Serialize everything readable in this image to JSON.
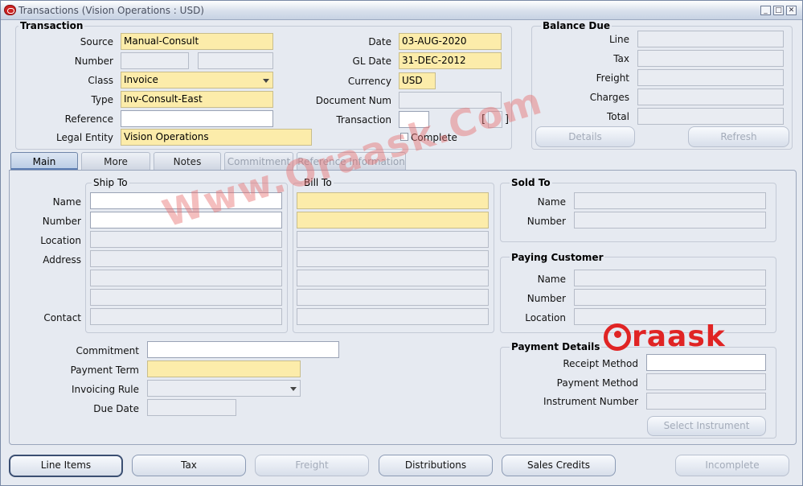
{
  "window": {
    "title": "Transactions (Vision Operations : USD)"
  },
  "transaction": {
    "section_title": "Transaction",
    "source_label": "Source",
    "source_value": "Manual-Consult",
    "number_label": "Number",
    "number_value": "",
    "class_label": "Class",
    "class_value": "Invoice",
    "type_label": "Type",
    "type_value": "Inv-Consult-East",
    "reference_label": "Reference",
    "reference_value": "",
    "legal_entity_label": "Legal Entity",
    "legal_entity_value": "Vision Operations",
    "date_label": "Date",
    "date_value": "03-AUG-2020",
    "gl_date_label": "GL Date",
    "gl_date_value": "31-DEC-2012",
    "currency_label": "Currency",
    "currency_value": "USD",
    "document_num_label": "Document Num",
    "document_num_value": "",
    "transaction_label": "Transaction",
    "transaction_value": "",
    "complete_label": "Complete",
    "complete_checked": false,
    "bracket_open": "[",
    "bracket_close": "]"
  },
  "balance_due": {
    "section_title": "Balance Due",
    "line_label": "Line",
    "tax_label": "Tax",
    "freight_label": "Freight",
    "charges_label": "Charges",
    "total_label": "Total",
    "details_button": "Details",
    "refresh_button": "Refresh"
  },
  "tabs": [
    {
      "label": "Main",
      "state": "active"
    },
    {
      "label": "More",
      "state": "normal"
    },
    {
      "label": "Notes",
      "state": "normal"
    },
    {
      "label": "Commitment",
      "state": "disabled"
    },
    {
      "label": "Reference Information",
      "state": "disabled"
    }
  ],
  "ship_to": {
    "section_title": "Ship To",
    "name_label": "Name",
    "number_label": "Number",
    "location_label": "Location",
    "address_label": "Address",
    "contact_label": "Contact"
  },
  "bill_to": {
    "section_title": "Bill To"
  },
  "sold_to": {
    "section_title": "Sold To",
    "name_label": "Name",
    "number_label": "Number"
  },
  "paying_customer": {
    "section_title": "Paying Customer",
    "name_label": "Name",
    "number_label": "Number",
    "location_label": "Location"
  },
  "main_lower": {
    "commitment_label": "Commitment",
    "payment_term_label": "Payment Term",
    "invoicing_rule_label": "Invoicing Rule",
    "due_date_label": "Due Date"
  },
  "payment_details": {
    "section_title": "Payment Details",
    "receipt_method_label": "Receipt Method",
    "payment_method_label": "Payment Method",
    "instrument_number_label": "Instrument Number",
    "select_instrument_button": "Select Instrument"
  },
  "bottom_buttons": {
    "line_items": "Line Items",
    "tax": "Tax",
    "freight": "Freight",
    "distributions": "Distributions",
    "sales_credits": "Sales Credits",
    "incomplete": "Incomplete"
  },
  "watermark": {
    "text": "Www.Oraask.Com",
    "logo_text": "raask"
  },
  "colors": {
    "required_field": "#fcecaa",
    "window_bg": "#e6eaf1",
    "watermark": "#e06e6e",
    "logo": "#e02424"
  }
}
